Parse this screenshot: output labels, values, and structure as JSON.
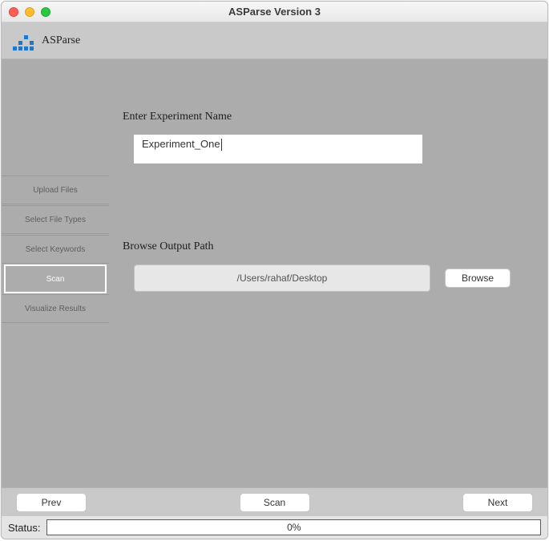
{
  "window": {
    "title": "ASParse Version 3"
  },
  "brand": {
    "name": "ASParse"
  },
  "sidebar": {
    "steps": [
      {
        "label": "Upload Files"
      },
      {
        "label": "Select File Types"
      },
      {
        "label": "Select Keywords"
      },
      {
        "label": "Scan"
      },
      {
        "label": "Visualize Results"
      }
    ],
    "active_index": 3
  },
  "form": {
    "experiment_label": "Enter Experiment Name",
    "experiment_value": "Experiment_One",
    "outputpath_label": "Browse Output Path",
    "outputpath_value": "/Users/rahaf/Desktop",
    "browse_label": "Browse"
  },
  "footer": {
    "prev": "Prev",
    "scan": "Scan",
    "next": "Next"
  },
  "status": {
    "label": "Status:",
    "progress_text": "0%"
  }
}
